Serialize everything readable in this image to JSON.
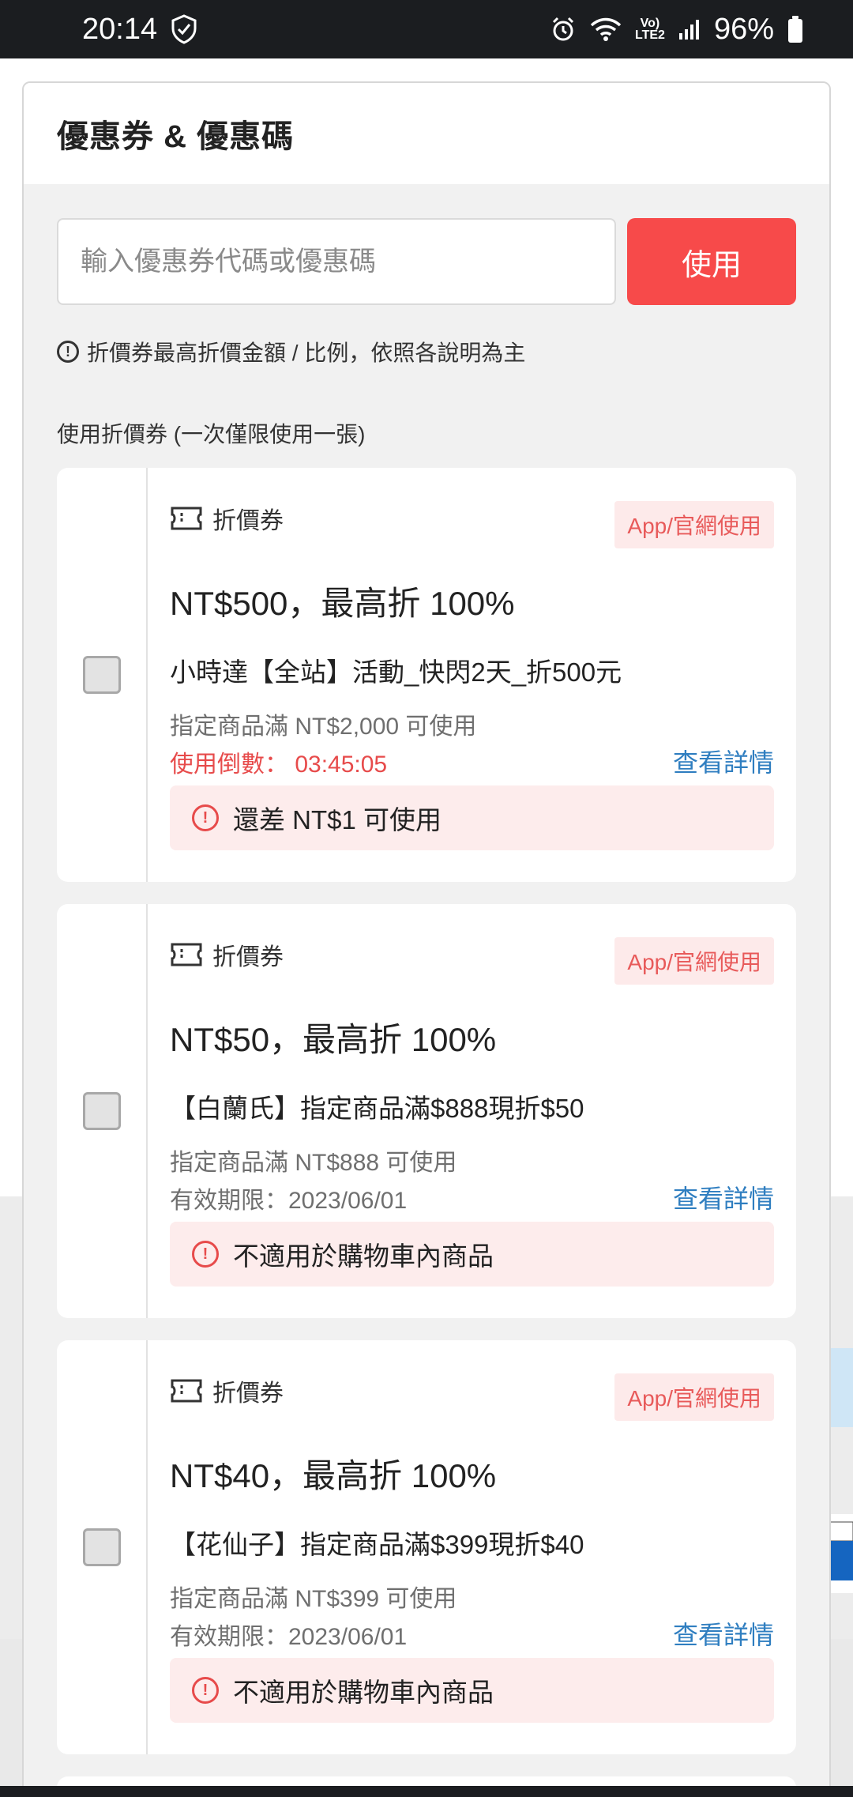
{
  "status_bar": {
    "time": "20:14",
    "signal_label_top": "Vo)",
    "signal_label_bottom": "LTE2",
    "battery": "96%"
  },
  "dialog": {
    "title": "優惠券 & 優惠碼",
    "code_input_placeholder": "輸入優惠券代碼或優惠碼",
    "use_button": "使用",
    "note": "折價券最高折價金額 / 比例，依照各說明為主",
    "section_label": "使用折價券 (一次僅限使用一張)"
  },
  "coupons": [
    {
      "type": "折價券",
      "badge": "App/官網使用",
      "amount": "NT$500，最高折 100%",
      "name": "小時達【全站】活動_快閃2天_折500元",
      "condition": "指定商品滿 NT$2,000 可使用",
      "expiry": "使用倒數： 03:45:05",
      "detail": "查看詳情",
      "warning": "還差 NT$1 可使用"
    },
    {
      "type": "折價券",
      "badge": "App/官網使用",
      "amount": "NT$50，最高折 100%",
      "name": "【白蘭氏】指定商品滿$888現折$50",
      "condition": "指定商品滿 NT$888 可使用",
      "expiry": "有效期限：2023/06/01",
      "detail": "查看詳情",
      "warning": "不適用於購物車內商品"
    },
    {
      "type": "折價券",
      "badge": "App/官網使用",
      "amount": "NT$40，最高折 100%",
      "name": "【花仙子】指定商品滿$399現折$40",
      "condition": "指定商品滿 NT$399 可使用",
      "expiry": "有效期限：2023/06/01",
      "detail": "查看詳情",
      "warning": "不適用於購物車內商品"
    }
  ],
  "colors": {
    "accent": "#f74a4a",
    "link": "#2f7ec0",
    "countdown": "#e74b4b"
  }
}
